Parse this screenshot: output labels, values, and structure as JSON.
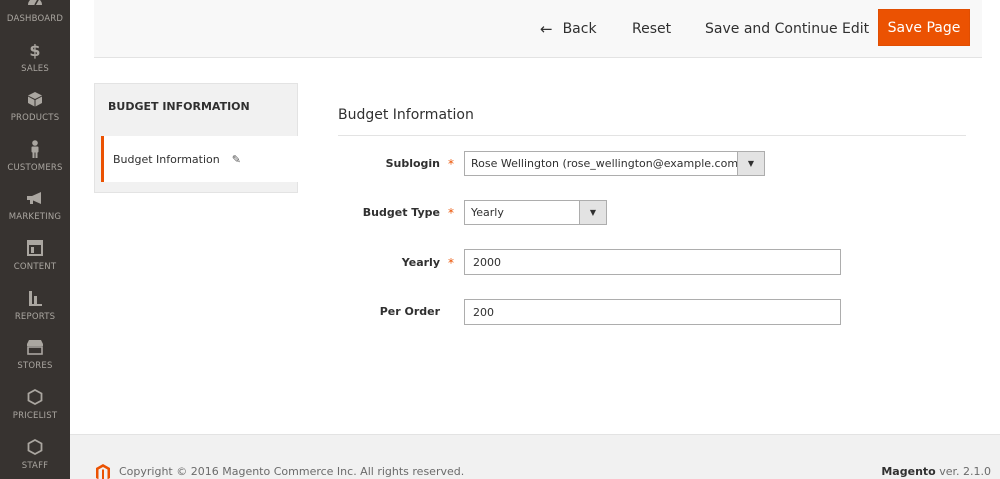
{
  "sidebar": {
    "items": [
      {
        "label": "DASHBOARD",
        "icon": "dashboard-icon"
      },
      {
        "label": "SALES",
        "icon": "dollar-icon"
      },
      {
        "label": "PRODUCTS",
        "icon": "box-icon"
      },
      {
        "label": "CUSTOMERS",
        "icon": "person-icon"
      },
      {
        "label": "MARKETING",
        "icon": "megaphone-icon"
      },
      {
        "label": "CONTENT",
        "icon": "layout-icon"
      },
      {
        "label": "REPORTS",
        "icon": "bar-chart-icon"
      },
      {
        "label": "STORES",
        "icon": "store-icon"
      },
      {
        "label": "PRICELIST",
        "icon": "hexagon-icon"
      },
      {
        "label": "STAFF",
        "icon": "hexagon-icon"
      }
    ]
  },
  "actions": {
    "back": "Back",
    "reset": "Reset",
    "save_continue": "Save and Continue Edit",
    "save": "Save Page"
  },
  "tabs": {
    "title": "BUDGET INFORMATION",
    "items": [
      {
        "label": "Budget Information"
      }
    ]
  },
  "form": {
    "title": "Budget Information",
    "sublogin": {
      "label": "Sublogin",
      "value": "Rose Wellington (rose_wellington@example.com)"
    },
    "budget_type": {
      "label": "Budget Type",
      "value": "Yearly"
    },
    "yearly": {
      "label": "Yearly",
      "value": "2000"
    },
    "per_order": {
      "label": "Per Order",
      "value": "200"
    }
  },
  "footer": {
    "copyright": "Copyright © 2016 Magento Commerce Inc. All rights reserved.",
    "brand": "Magento",
    "version": "ver. 2.1.0"
  },
  "colors": {
    "accent": "#eb5202",
    "sidebar_bg": "#373330"
  }
}
